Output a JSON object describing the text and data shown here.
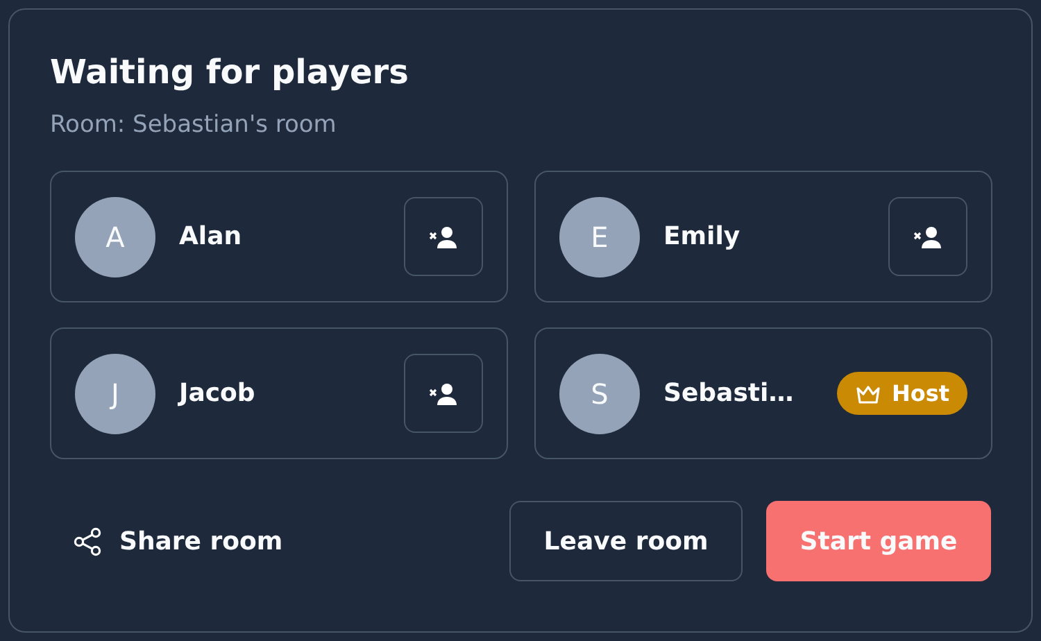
{
  "title": "Waiting for players",
  "subtitle": "Room: Sebastian's room",
  "players": [
    {
      "initial": "A",
      "name": "Alan",
      "host": false
    },
    {
      "initial": "E",
      "name": "Emily",
      "host": false
    },
    {
      "initial": "J",
      "name": "Jacob",
      "host": false
    },
    {
      "initial": "S",
      "name": "Sebasti…",
      "host": true,
      "badge": "Host"
    }
  ],
  "share": "Share room",
  "leave": "Leave room",
  "start": "Start game"
}
